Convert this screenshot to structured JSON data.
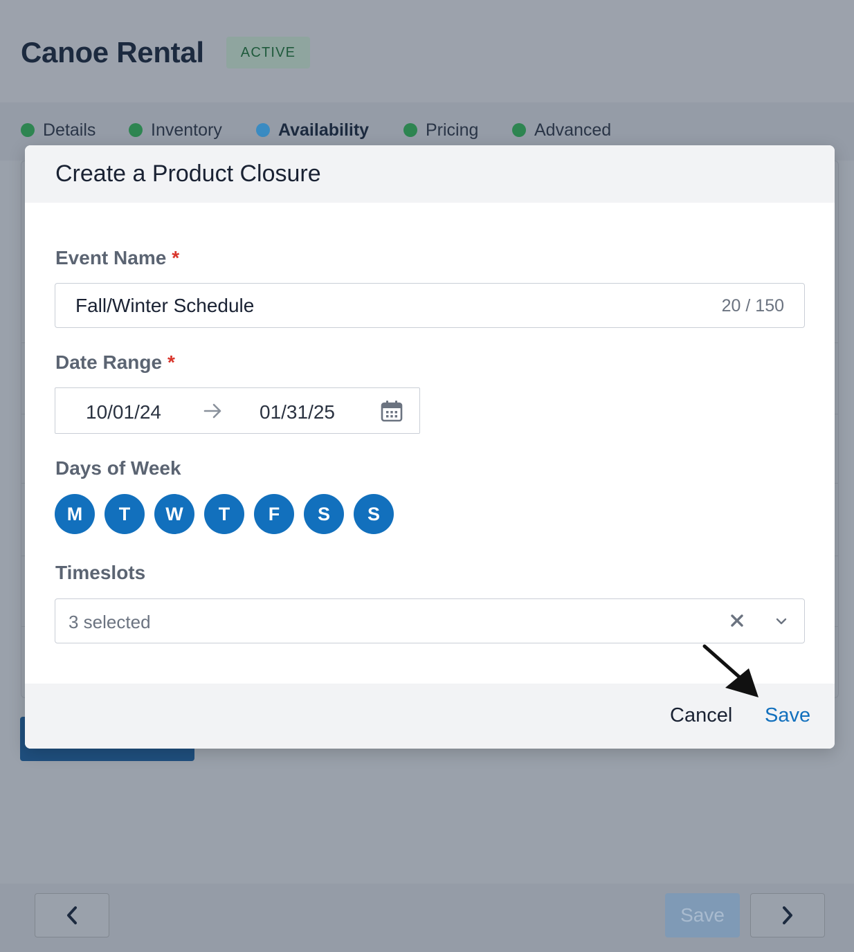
{
  "page": {
    "title": "Canoe Rental",
    "status": "ACTIVE"
  },
  "steps": [
    {
      "label": "Details",
      "dot_color": "#2e8551",
      "active": false
    },
    {
      "label": "Inventory",
      "dot_color": "#2e8551",
      "active": false
    },
    {
      "label": "Availability",
      "dot_color": "#3a8bc2",
      "active": true
    },
    {
      "label": "Pricing",
      "dot_color": "#2e8551",
      "active": false
    },
    {
      "label": "Advanced",
      "dot_color": "#2e8551",
      "active": false
    }
  ],
  "modal": {
    "title": "Create a Product Closure",
    "event_name": {
      "label": "Event Name",
      "required_mark": "*",
      "value": "Fall/Winter Schedule",
      "counter": "20 / 150"
    },
    "date_range": {
      "label": "Date Range",
      "required_mark": "*",
      "start": "10/01/24",
      "end": "01/31/25",
      "icon": "calendar-icon"
    },
    "days_of_week": {
      "label": "Days of Week",
      "days": [
        "M",
        "T",
        "W",
        "T",
        "F",
        "S",
        "S"
      ]
    },
    "timeslots": {
      "label": "Timeslots",
      "value": "3 selected",
      "clear_icon": "close-icon",
      "dropdown_icon": "chevron-down-icon"
    },
    "footer": {
      "cancel_label": "Cancel",
      "save_label": "Save"
    }
  },
  "footer_bar": {
    "prev_icon": "chevron-left-icon",
    "save_label": "Save",
    "next_icon": "chevron-right-icon"
  },
  "colors": {
    "accent": "#1270bd",
    "required": "#d9352b",
    "step_complete": "#2e8551",
    "step_current": "#3a8bc2"
  }
}
